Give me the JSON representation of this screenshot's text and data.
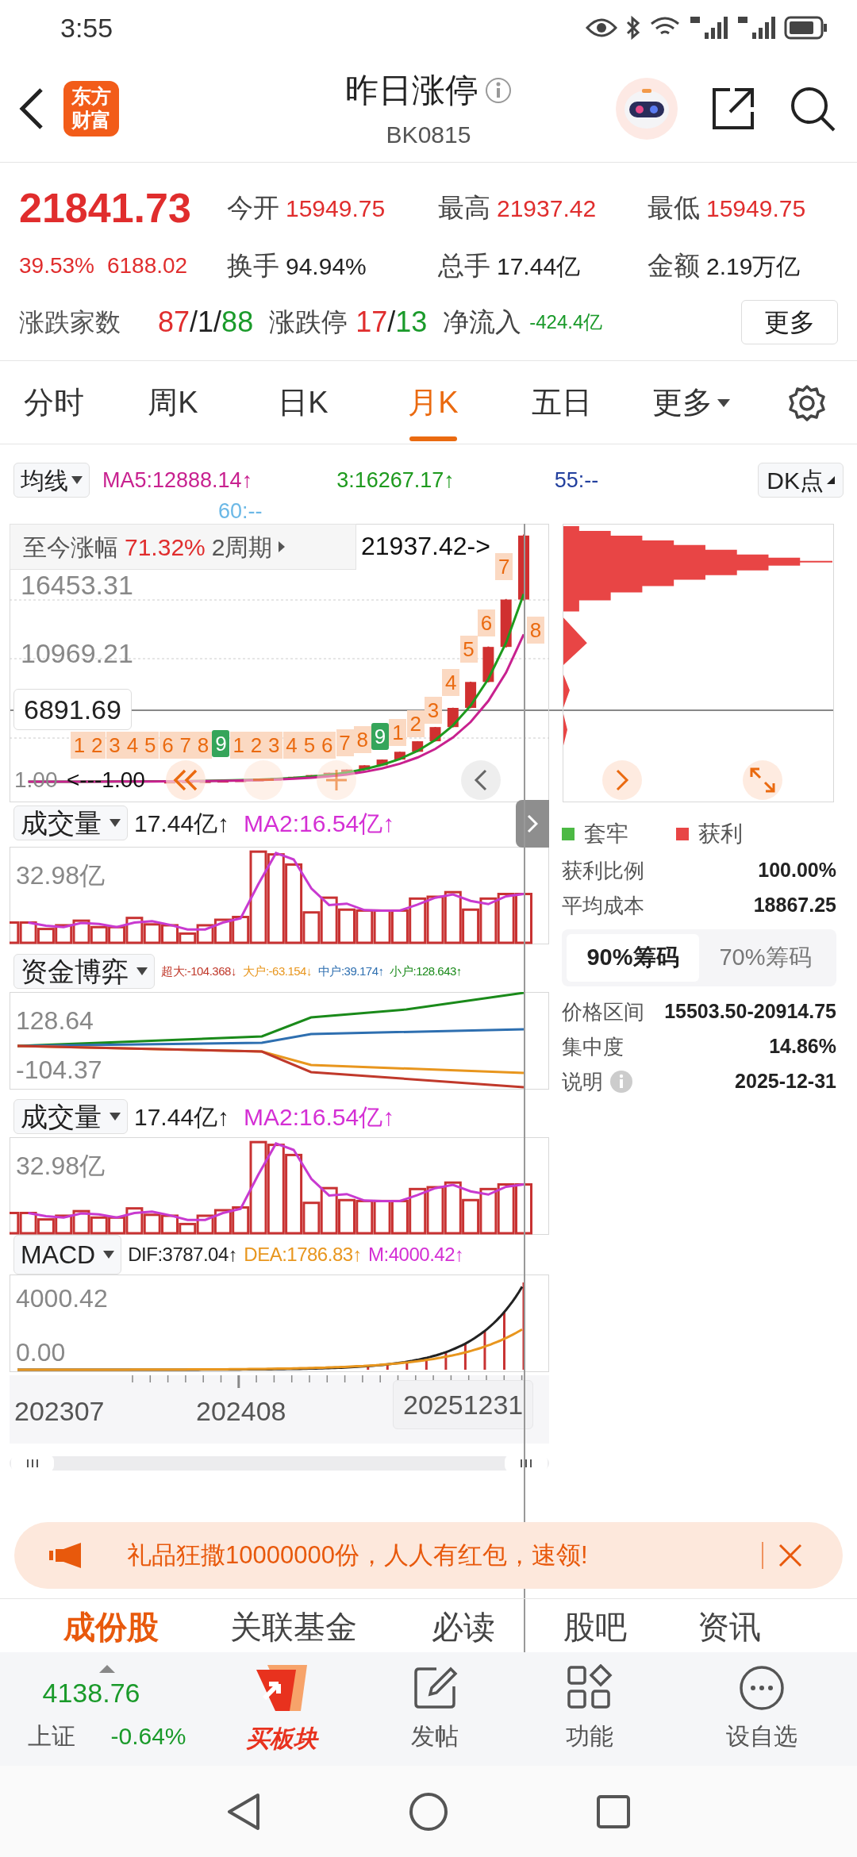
{
  "status_bar": {
    "time": "3:55"
  },
  "header": {
    "logo": [
      "东方",
      "财富"
    ],
    "title": "昨日涨停",
    "code": "BK0815"
  },
  "quote": {
    "price": "21841.73",
    "change_pct": "39.53%",
    "change": "6188.02",
    "stats": [
      {
        "label": "今开",
        "value": "15949.75",
        "kind": "up"
      },
      {
        "label": "最高",
        "value": "21937.42",
        "kind": "up"
      },
      {
        "label": "最低",
        "value": "15949.75",
        "kind": "up"
      },
      {
        "label": "换手",
        "value": "94.94%",
        "kind": "flat"
      },
      {
        "label": "总手",
        "value": "17.44亿",
        "kind": "flat"
      },
      {
        "label": "金额",
        "value": "2.19万亿",
        "kind": "flat"
      }
    ],
    "breadth": {
      "label": "涨跌家数",
      "parts": [
        {
          "text": "87",
          "kind": "up"
        },
        {
          "text": "/",
          "kind": "flat"
        },
        {
          "text": "1",
          "kind": "flat"
        },
        {
          "text": "/",
          "kind": "flat"
        },
        {
          "text": "88",
          "kind": "down"
        }
      ]
    },
    "limits": {
      "label": "涨跌停",
      "parts": [
        {
          "text": "17",
          "kind": "up"
        },
        {
          "text": "/",
          "kind": "flat"
        },
        {
          "text": "13",
          "kind": "down"
        }
      ]
    },
    "net_inflow": {
      "label": "净流入",
      "value": "-424.4亿",
      "kind": "down"
    },
    "more_button": "更多"
  },
  "period_tabs": [
    {
      "label": "分时",
      "selected": false,
      "dropdown": false
    },
    {
      "label": "周K",
      "selected": false,
      "dropdown": false
    },
    {
      "label": "日K",
      "selected": false,
      "dropdown": false
    },
    {
      "label": "月K",
      "selected": true,
      "dropdown": false
    },
    {
      "label": "五日",
      "selected": false,
      "dropdown": false
    },
    {
      "label": "更多",
      "selected": false,
      "dropdown": true
    }
  ],
  "indicator_bar": {
    "selector": "均线",
    "ma": [
      {
        "text": "MA5:12888.14↑",
        "color": "#c8218f"
      },
      {
        "text": "3:16267.17↑",
        "color": "#1e9a1e"
      },
      {
        "text": "55:--",
        "color": "#23409e"
      },
      {
        "text": "60:--",
        "color": "#6bb8e6"
      }
    ],
    "dk_button": "DK点"
  },
  "main_chart": {
    "range_label": "至今涨幅",
    "range_value": "71.32%",
    "range_period": "2周期",
    "high_label": "21937.42->",
    "y_labels": [
      "16453.31",
      "10969.21"
    ],
    "cursor_price": "6891.69",
    "low_label": "<---1.00",
    "bottom_label": "1.00",
    "markers": [
      {
        "text": "1",
        "kind": "count"
      },
      {
        "text": "2",
        "kind": "count"
      },
      {
        "text": "3",
        "kind": "count"
      },
      {
        "text": "4",
        "kind": "count"
      },
      {
        "text": "5",
        "kind": "count"
      },
      {
        "text": "6",
        "kind": "count"
      },
      {
        "text": "7",
        "kind": "count"
      },
      {
        "text": "8",
        "kind": "count"
      },
      {
        "text": "9",
        "kind": "nine"
      },
      {
        "text": "1",
        "kind": "count"
      },
      {
        "text": "2",
        "kind": "count"
      },
      {
        "text": "3",
        "kind": "count"
      },
      {
        "text": "4",
        "kind": "count"
      },
      {
        "text": "5",
        "kind": "count"
      },
      {
        "text": "6",
        "kind": "count"
      },
      {
        "text": "7",
        "kind": "count"
      },
      {
        "text": "8",
        "kind": "count"
      },
      {
        "text": "9",
        "kind": "nine"
      },
      {
        "text": "1",
        "kind": "count"
      },
      {
        "text": "2",
        "kind": "count"
      },
      {
        "text": "3",
        "kind": "count"
      },
      {
        "text": "4",
        "kind": "count"
      },
      {
        "text": "5",
        "kind": "count"
      },
      {
        "text": "6",
        "kind": "count"
      },
      {
        "text": "7",
        "kind": "count"
      },
      {
        "text": "8",
        "kind": "count"
      }
    ]
  },
  "chip_panel": {
    "legend": [
      {
        "label": "套牢",
        "color": "#4cb944"
      },
      {
        "label": "获利",
        "color": "#e84545"
      }
    ],
    "rows": [
      {
        "label": "获利比例",
        "value": "100.00%"
      },
      {
        "label": "平均成本",
        "value": "18867.25"
      }
    ],
    "segments": [
      {
        "label": "90%筹码",
        "selected": true
      },
      {
        "label": "70%筹码",
        "selected": false
      }
    ],
    "details": [
      {
        "label": "价格区间",
        "value": "15503.50-20914.75",
        "info": false
      },
      {
        "label": "集中度",
        "value": "14.86%",
        "info": false
      },
      {
        "label": "说明",
        "value": "2025-12-31",
        "info": true
      }
    ]
  },
  "sub_panels": [
    {
      "kind": "volume",
      "selector": "成交量",
      "readings": [
        {
          "text": "17.44亿↑",
          "color": "#222222"
        },
        {
          "text": "MA2:16.54亿↑",
          "color": "#d42fd4"
        }
      ],
      "axis_labels": [
        "32.98亿"
      ]
    },
    {
      "kind": "fund",
      "selector": "资金博弈",
      "readings": [
        {
          "text": "超大:-104.368↓",
          "color": "#c0392b"
        },
        {
          "text": "大户:-63.154↓",
          "color": "#e8961e"
        },
        {
          "text": "中户:39.174↑",
          "color": "#2e6fb0"
        },
        {
          "text": "小户:128.643↑",
          "color": "#1a8a1a"
        }
      ],
      "axis_labels": [
        "128.64",
        "-104.37"
      ]
    },
    {
      "kind": "volume",
      "selector": "成交量",
      "readings": [
        {
          "text": "17.44亿↑",
          "color": "#222222"
        },
        {
          "text": "MA2:16.54亿↑",
          "color": "#d42fd4"
        }
      ],
      "axis_labels": [
        "32.98亿"
      ]
    },
    {
      "kind": "macd",
      "selector": "MACD",
      "readings": [
        {
          "text": "DIF:3787.04↑",
          "color": "#222222"
        },
        {
          "text": "DEA:1786.83↑",
          "color": "#e8961e"
        },
        {
          "text": "M:4000.42↑",
          "color": "#d42fd4"
        }
      ],
      "axis_labels": [
        "4000.42",
        "0.00"
      ]
    }
  ],
  "date_axis": [
    "202307",
    "202408",
    "20251231"
  ],
  "banner": {
    "text": "礼品狂撒10000000份，人人有红包，速领!"
  },
  "content_tabs": [
    {
      "label": "成份股",
      "selected": true
    },
    {
      "label": "关联基金",
      "selected": false
    },
    {
      "label": "必读",
      "selected": false
    },
    {
      "label": "股吧",
      "selected": false
    },
    {
      "label": "资讯",
      "selected": false
    }
  ],
  "bottom_nav": {
    "index": {
      "value": "4138.76",
      "name": "上证",
      "change": "-0.64%"
    },
    "items": [
      {
        "label": "买板块",
        "kind": "brand"
      },
      {
        "label": "发帖",
        "kind": "post"
      },
      {
        "label": "功能",
        "kind": "grid"
      },
      {
        "label": "设自选",
        "kind": "more"
      }
    ]
  }
}
